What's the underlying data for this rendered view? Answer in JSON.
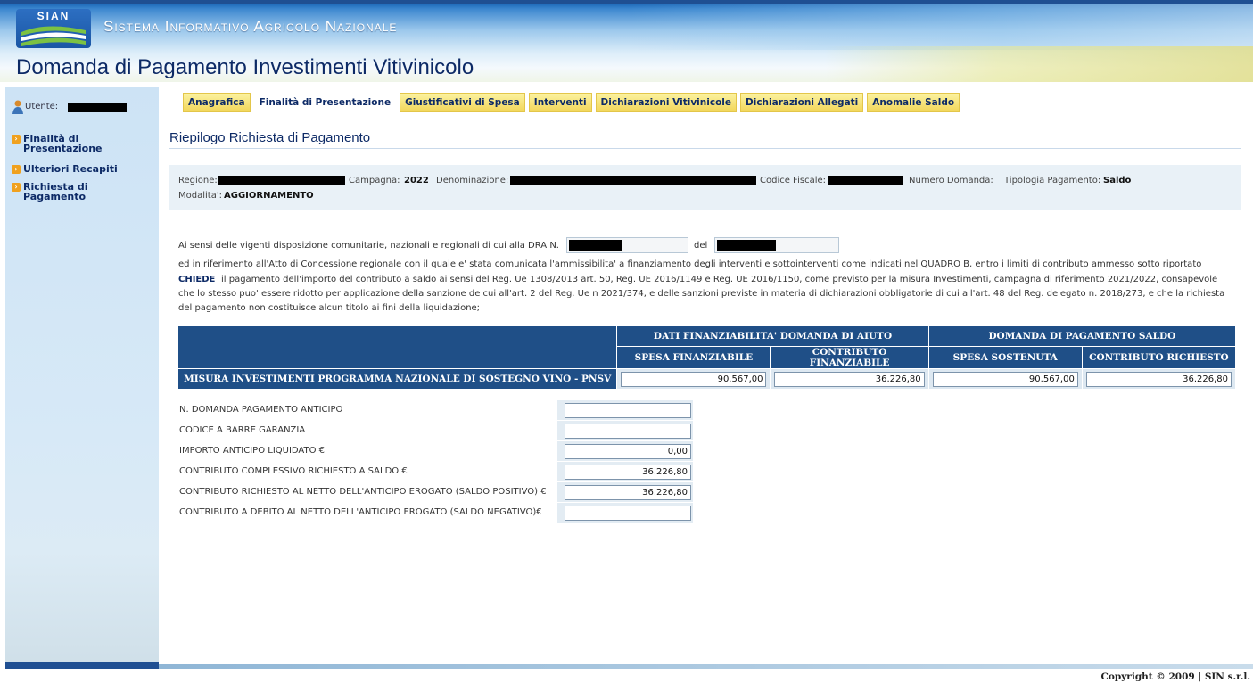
{
  "header": {
    "logo_text": "SIAN",
    "system_title": "Sistema Informativo Agricolo Nazionale",
    "app_title": "Domanda di Pagamento Investimenti Vitivinicolo"
  },
  "sidebar": {
    "user_label": "Utente:",
    "items": [
      {
        "label": "Finalità di Presentazione"
      },
      {
        "label": "Ulteriori Recapiti"
      },
      {
        "label": "Richiesta di Pagamento"
      }
    ]
  },
  "tabs": [
    {
      "label": "Anagrafica"
    },
    {
      "label": "Finalità di Presentazione"
    },
    {
      "label": "Giustificativi di Spesa"
    },
    {
      "label": "Interventi"
    },
    {
      "label": "Dichiarazioni Vitivinicole"
    },
    {
      "label": "Dichiarazioni Allegati"
    },
    {
      "label": "Anomalie Saldo"
    }
  ],
  "active_tab": "Finalità di Presentazione",
  "page_title": "Riepilogo Richiesta di Pagamento",
  "info": {
    "regione_label": "Regione:",
    "campagna_label": "Campagna:",
    "campagna_value": "2022",
    "denominazione_label": "Denominazione:",
    "codice_fiscale_label": "Codice Fiscale:",
    "numero_domanda_label": "Numero Domanda:",
    "tipologia_label": "Tipologia Pagamento:",
    "tipologia_value": "Saldo",
    "modalita_label": "Modalita':",
    "modalita_value": "AGGIORNAMENTO"
  },
  "declaration": {
    "line1_prefix": "Ai sensi delle vigenti disposizione comunitarie, nazionali e regionali di cui alla DRA N.",
    "line1_del": "del",
    "line2": "ed in riferimento all'Atto di Concessione regionale con il quale e' stata comunicata l'ammissibilita' a finanziamento degli interventi e sottointerventi come indicati nel QUADRO B, entro i limiti di contributo ammesso sotto riportato",
    "chiede": "CHIEDE",
    "line3": "il pagamento dell'importo del contributo a saldo ai sensi del Reg. Ue 1308/2013 art. 50, Reg. UE 2016/1149 e Reg. UE 2016/1150, come previsto per la misura Investimenti, campagna di riferimento 2021/2022, consapevole",
    "line4": "che lo stesso puo' essere ridotto per applicazione della sanzione de cui all'art. 2 del Reg. Ue n 2021/374, e delle sanzioni previste in materia di dichiarazioni obbligatorie di cui all'art. 48 del Reg. delegato n. 2018/273, e che la richiesta",
    "line5": "del pagamento non costituisce alcun titolo ai fini della liquidazione;"
  },
  "table": {
    "group1": "DATI FINANZIABILITA' DOMANDA DI AIUTO",
    "group2": "DOMANDA DI PAGAMENTO SALDO",
    "columns": [
      "SPESA FINANZIABILE",
      "CONTRIBUTO FINANZIABILE",
      "SPESA SOSTENUTA",
      "CONTRIBUTO RICHIESTO"
    ],
    "row_label": "MISURA INVESTIMENTI PROGRAMMA NAZIONALE DI SOSTEGNO VINO - PNSV",
    "row_values": [
      "90.567,00",
      "36.226,80",
      "90.567,00",
      "36.226,80"
    ]
  },
  "form": [
    {
      "label": "N. DOMANDA PAGAMENTO ANTICIPO",
      "value": ""
    },
    {
      "label": "CODICE A BARRE GARANZIA",
      "value": ""
    },
    {
      "label": "IMPORTO ANTICIPO LIQUIDATO €",
      "value": "0,00"
    },
    {
      "label": "CONTRIBUTO COMPLESSIVO RICHIESTO A SALDO €",
      "value": "36.226,80"
    },
    {
      "label": "CONTRIBUTO RICHIESTO AL NETTO DELL'ANTICIPO EROGATO (SALDO POSITIVO) €",
      "value": "36.226,80"
    },
    {
      "label": "CONTRIBUTO A DEBITO AL NETTO DELL'ANTICIPO EROGATO (SALDO NEGATIVO)€",
      "value": ""
    }
  ],
  "footer": {
    "copyright": "Copyright © 2009 | SIN s.r.l."
  },
  "colors": {
    "header_blue": "#1f4f92",
    "tab_yellow": "#f2d65a",
    "table_blue": "#1f4f87",
    "sidebar_bg": "#cde3f5"
  }
}
